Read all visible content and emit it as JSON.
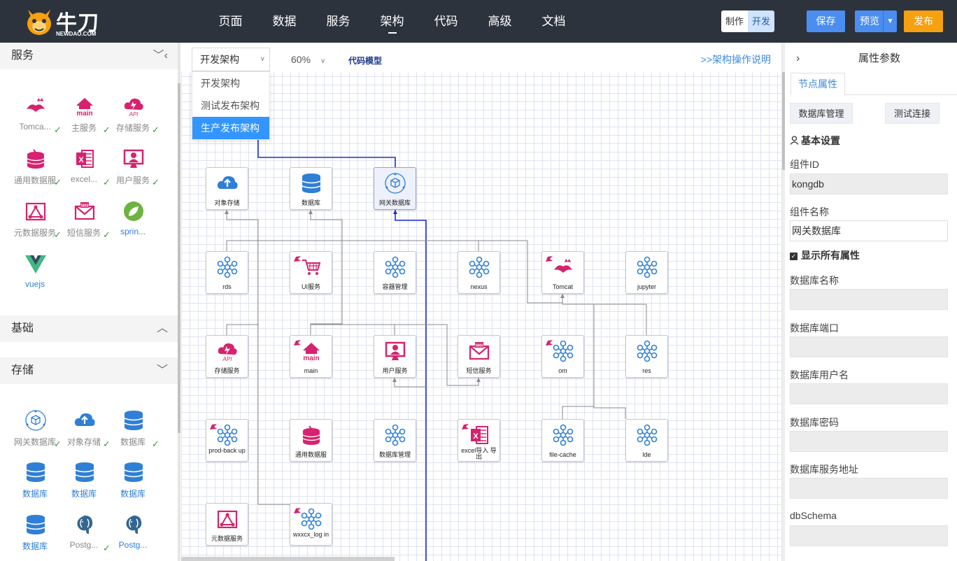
{
  "header": {
    "logo_text": "牛刀",
    "logo_sub": "NEWDAO.COM",
    "nav": [
      "页面",
      "数据",
      "服务",
      "架构",
      "代码",
      "高级",
      "文档"
    ],
    "mode_make": "制作",
    "mode_dev": "开发",
    "save": "保存",
    "preview": "预览",
    "publish": "发布"
  },
  "left": {
    "sections": {
      "service": "服务",
      "base": "基础",
      "storage": "存储"
    },
    "service_items": [
      {
        "label": "Tomca...",
        "icon": "tomcat-icon",
        "color": "#d6226f"
      },
      {
        "label": "主服务",
        "icon": "main-icon",
        "color": "#d6226f"
      },
      {
        "label": "存储服务",
        "icon": "api-cloud-icon",
        "color": "#d6226f"
      },
      {
        "label": "通用数据服",
        "icon": "database-service-icon",
        "color": "#d6226f"
      },
      {
        "label": "excel...",
        "icon": "excel-icon",
        "color": "#d6226f"
      },
      {
        "label": "用户服务",
        "icon": "user-service-icon",
        "color": "#d6226f"
      },
      {
        "label": "元数据服务",
        "icon": "metadata-icon",
        "color": "#d6226f"
      },
      {
        "label": "短信服务",
        "icon": "sms-icon",
        "color": "#d6226f"
      },
      {
        "label": "sprin...",
        "icon": "spring-icon",
        "color": "#4caf50"
      },
      {
        "label": "vuejs",
        "icon": "vue-icon",
        "color": "#3fb27f"
      }
    ],
    "storage_items": [
      {
        "label": "网关数据库",
        "icon": "gateway-db-icon"
      },
      {
        "label": "对象存储",
        "icon": "object-storage-icon"
      },
      {
        "label": "数据库",
        "icon": "database-icon"
      },
      {
        "label": "数据库",
        "icon": "database-icon"
      },
      {
        "label": "数据库",
        "icon": "database-icon"
      },
      {
        "label": "数据库",
        "icon": "database-icon"
      },
      {
        "label": "数据库",
        "icon": "database-icon"
      },
      {
        "label": "Postg...",
        "icon": "postgres-icon"
      },
      {
        "label": "Postg...",
        "icon": "postgres-icon"
      }
    ],
    "check": "✓"
  },
  "canvas": {
    "selector_value": "开发架构",
    "dropdown_options": [
      "开发架构",
      "测试发布架构",
      "生产发布架构"
    ],
    "zoom": "60%",
    "code_model": "代码模型",
    "help": ">>架构操作说明",
    "nodes": [
      {
        "label": "对象存储",
        "icon": "object-storage-icon"
      },
      {
        "label": "数据库",
        "icon": "database-icon"
      },
      {
        "label": "网关数据库",
        "icon": "gateway-db-icon"
      },
      {
        "label": "rds",
        "icon": "cluster-icon"
      },
      {
        "label": "UI服务",
        "icon": "cart-icon"
      },
      {
        "label": "容器管理",
        "icon": "cluster-icon"
      },
      {
        "label": "nexus",
        "icon": "cluster-icon"
      },
      {
        "label": "Tomcat",
        "icon": "tomcat-icon"
      },
      {
        "label": "jupyter",
        "icon": "cluster-icon"
      },
      {
        "label": "存储服务",
        "icon": "api-cloud-icon"
      },
      {
        "label": "main",
        "icon": "main-icon"
      },
      {
        "label": "用户服务",
        "icon": "user-service-icon"
      },
      {
        "label": "短信服务",
        "icon": "sms-icon"
      },
      {
        "label": "om",
        "icon": "cluster-icon"
      },
      {
        "label": "res",
        "icon": "cluster-icon"
      },
      {
        "label": "prod-back up",
        "icon": "cluster-icon"
      },
      {
        "label": "通用数据服",
        "icon": "database-service-icon"
      },
      {
        "label": "数据库管理",
        "icon": "cluster-icon"
      },
      {
        "label": "excel导入 导出",
        "icon": "excel-icon"
      },
      {
        "label": "file-cache",
        "icon": "cluster-icon"
      },
      {
        "label": "lde",
        "icon": "cluster-icon"
      },
      {
        "label": "元数据服务",
        "icon": "metadata-icon"
      },
      {
        "label": "wxxcx_log in",
        "icon": "cluster-icon"
      }
    ]
  },
  "right": {
    "title": "属性参数",
    "tab": "节点属性",
    "db_manage": "数据库管理",
    "test_conn": "测试连接",
    "basic": "基本设置",
    "fields": [
      {
        "label": "组件ID",
        "value": "kongdb"
      },
      {
        "label": "组件名称",
        "value": "网关数据库"
      }
    ],
    "show_all": "显示所有属性",
    "props": [
      "数据库名称",
      "数据库端口",
      "数据库用户名",
      "数据库密码",
      "数据库服务地址",
      "dbSchema"
    ]
  }
}
